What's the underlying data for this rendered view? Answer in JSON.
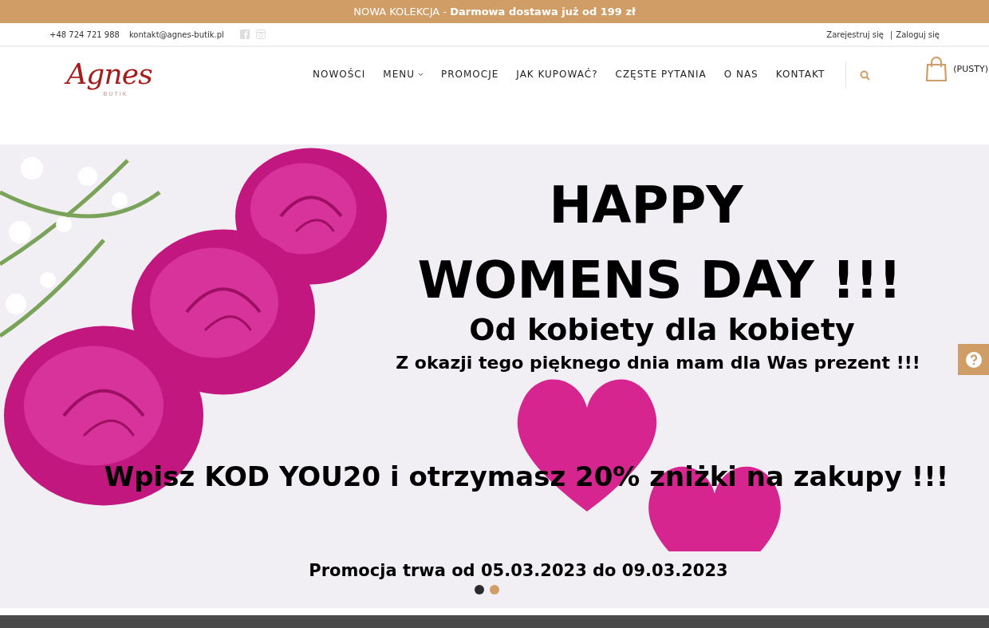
{
  "announcement": {
    "text": "NOWA KOLEKCJA - ",
    "highlight": "Darmowa dostawa już od 199 zł"
  },
  "contact_bar": {
    "phone": "+48 724 721 988",
    "email": "kontakt@agnes-butik.pl",
    "links": [
      "Zarejestruj się",
      "Zaloguj się"
    ],
    "separator": "|"
  },
  "logo": {
    "name": "Agnes",
    "subtitle": "BUTIK"
  },
  "nav": [
    {
      "label": "NOWOŚCI",
      "dropdown": false
    },
    {
      "label": "MENU",
      "dropdown": true
    },
    {
      "label": "PROMOCJE",
      "dropdown": false
    },
    {
      "label": "JAK KUPOWAĆ?",
      "dropdown": false
    },
    {
      "label": "CZĘSTE PYTANIA",
      "dropdown": false
    },
    {
      "label": "O NAS",
      "dropdown": false
    },
    {
      "label": "KONTAKT",
      "dropdown": false
    }
  ],
  "cart": {
    "label": "(PUSTY)"
  },
  "slide": {
    "title_lines": [
      "HAPPY",
      "WOMENS DAY !!!"
    ],
    "subtitle": "Od kobiety dla kobiety",
    "line": "Z okazji tego pięknego dnia mam dla Was prezent !!!",
    "code_line": "Wpisz KOD YOU20 i otrzymasz 20% zniżki na zakupy !!!",
    "dates": "Promocja trwa od 05.03.2023 do 09.03.2023"
  },
  "slider_dots": [
    {
      "selected": true
    },
    {
      "selected": false
    }
  ]
}
